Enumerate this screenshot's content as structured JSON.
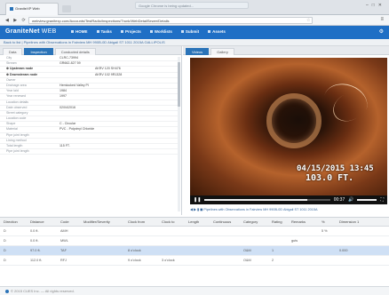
{
  "browser": {
    "tab_title": "GraniteXP Web",
    "notification": "Google Chrome is being updated...",
    "url": "webview.granitexp.com/Accounts/TestRadio/Inspections/Trunk/WebDetailSewer/Details"
  },
  "app": {
    "brand": "GraniteNet",
    "brand_suffix": "WEB",
    "nav": [
      "HOME",
      "Tasks",
      "Projects",
      "Worklists",
      "Submit",
      "Assets"
    ]
  },
  "breadcrumb": "Back to list  |  Pipelines with Observations in Fairview MH 990B-0D Abigail ST 1011 2015A GALLIPOLIS",
  "left_tabs": [
    "Data",
    "Inspection",
    "Conducted details"
  ],
  "fields": [
    {
      "label": "City",
      "value": "CLRC-73994"
    },
    {
      "label": "Stream",
      "value": "GR662-827 59"
    },
    {
      "label": "Upstream node",
      "value": "AKRV 120 SH476",
      "head": true
    },
    {
      "label": "Downstream node",
      "value": "AKRV 102 9R1328",
      "head": true
    },
    {
      "label": "Owner",
      "value": ""
    },
    {
      "label": "Drainage area",
      "value": "Hemlocked Valley PI"
    },
    {
      "label": "Year laid",
      "value": "1984"
    },
    {
      "label": "Year renewed",
      "value": "1997"
    },
    {
      "label": "Location details",
      "value": ""
    },
    {
      "label": "Date observed",
      "value": "02/04/2016"
    },
    {
      "label": "Street category",
      "value": ""
    },
    {
      "label": "Location code",
      "value": ""
    },
    {
      "label": "Shape",
      "value": "C - Circular"
    },
    {
      "label": "Material",
      "value": "PVC - Polyvinyl Chloride"
    },
    {
      "label": "Pipe joint length",
      "value": ""
    },
    {
      "label": "Lining method",
      "value": ""
    },
    {
      "label": "Total length",
      "value": "115 FT."
    },
    {
      "label": "Pipe joint length",
      "value": ""
    }
  ],
  "right_tabs": [
    "Videos",
    "Gallery"
  ],
  "video": {
    "overlay_date": "04/15/2015 13:45",
    "overlay_distance": "103.0 FT.",
    "time": "00:37",
    "progress": 0.82,
    "info": "Pipelines with Observations in Fairview MH 990B-0D Abigail ST 1011 2015A"
  },
  "grid": {
    "columns": [
      "Direction",
      "Distance",
      "Code",
      "Modifier/Severity",
      "Clock from",
      "Clock to",
      "Length",
      "Continuous",
      "Category",
      "Rating",
      "Remarks",
      "%",
      "Dimension 1"
    ],
    "rows": [
      {
        "cells": [
          "D",
          "0.0 ft.",
          "AMH",
          "",
          "",
          "",
          "",
          "",
          "",
          "",
          "",
          "5 %",
          ""
        ],
        "selected": false
      },
      {
        "cells": [
          "D",
          "0.0 ft.",
          "MWL",
          "",
          "",
          "",
          "",
          "",
          "",
          "",
          "guts",
          "",
          ""
        ],
        "selected": false
      },
      {
        "cells": [
          "D",
          "97.0 ft.",
          "TAF",
          "",
          "8 o'clock",
          "",
          "",
          "",
          "O&M",
          "1",
          "",
          "",
          "0.000"
        ],
        "selected": true
      },
      {
        "cells": [
          "D",
          "112.0 ft.",
          "RFJ",
          "",
          "9 o'clock",
          "3 o'clock",
          "",
          "",
          "O&M",
          "2",
          "",
          "",
          ""
        ],
        "selected": false
      }
    ]
  },
  "footer": "© 2015 CUES Inc. — All rights reserved."
}
